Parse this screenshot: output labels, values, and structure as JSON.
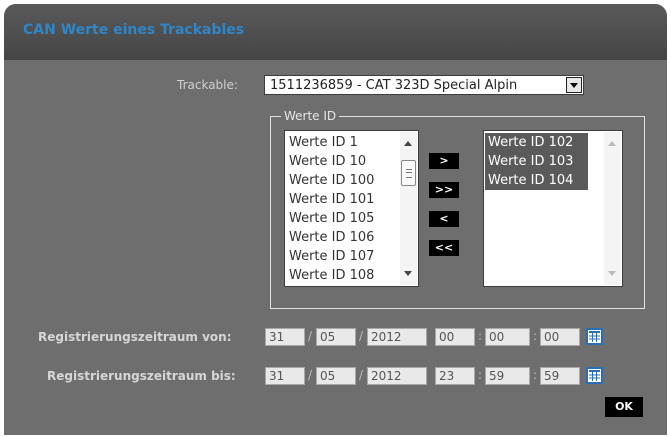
{
  "dialog": {
    "title": "CAN Werte eines Trackables"
  },
  "trackable": {
    "label": "Trackable:",
    "selected": "1511236859 - CAT 323D Special Alpin"
  },
  "werte": {
    "legend": "Werte ID",
    "available": [
      "Werte ID 1",
      "Werte ID 10",
      "Werte ID 100",
      "Werte ID 101",
      "Werte ID 105",
      "Werte ID 106",
      "Werte ID 107",
      "Werte ID 108"
    ],
    "selected": [
      "Werte ID 102",
      "Werte ID 103",
      "Werte ID 104"
    ],
    "buttons": {
      "move_one_right": ">",
      "move_all_right": ">>",
      "move_one_left": "<",
      "move_all_left": "<<"
    }
  },
  "von": {
    "label": "Registrierungszeitraum von:",
    "day": "31",
    "month": "05",
    "year": "2012",
    "hour": "00",
    "minute": "00",
    "second": "00"
  },
  "bis": {
    "label": "Registrierungszeitraum bis:",
    "day": "31",
    "month": "05",
    "year": "2012",
    "hour": "23",
    "minute": "59",
    "second": "59"
  },
  "separators": {
    "date": "/",
    "time": ":"
  },
  "ok_label": "OK",
  "colors": {
    "title": "#2f86c9",
    "dialog_bg": "#6e6e6e",
    "selected_item_bg": "#5a5a5a",
    "calendar_border": "#2a6fb5"
  }
}
